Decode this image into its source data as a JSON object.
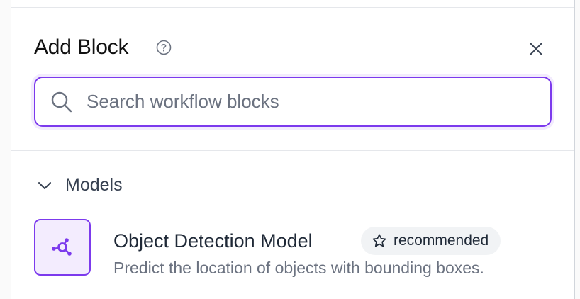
{
  "panel": {
    "title": "Add Block",
    "help_icon": "question-circle-icon",
    "close_icon": "close-icon"
  },
  "search": {
    "value": "",
    "placeholder": "Search workflow blocks",
    "icon": "search-icon"
  },
  "sections": [
    {
      "label": "Models",
      "icon": "chevron-down-icon",
      "expanded": true,
      "blocks": [
        {
          "title": "Object Detection Model",
          "badge": "recommended",
          "badge_icon": "star-icon",
          "description": "Predict the location of objects with bounding boxes.",
          "icon": "object-detection-icon"
        }
      ]
    }
  ],
  "colors": {
    "accent": "#7c3aed",
    "accent_tint": "#f3ecfe",
    "badge_bg": "#f1f3f5",
    "muted_text": "#6b7280"
  }
}
